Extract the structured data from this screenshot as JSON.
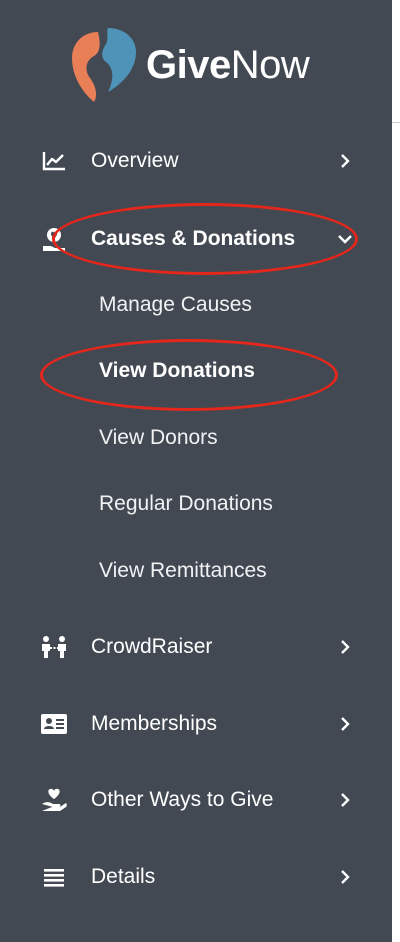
{
  "brand": {
    "name_bold": "Give",
    "name_regular": "Now"
  },
  "colors": {
    "sidebar_bg": "#434953",
    "text": "#ffffff",
    "annotation": "#e4261b",
    "logo_orange": "#e87f56",
    "logo_blue": "#4d94b8"
  },
  "nav": {
    "overview": {
      "label": "Overview",
      "icon": "line-chart-icon"
    },
    "causes": {
      "label": "Causes & Donations",
      "icon": "heart-hand-icon",
      "expanded": true,
      "sub_items": [
        {
          "label": "Manage Causes"
        },
        {
          "label": "View Donations",
          "active": true
        },
        {
          "label": "View Donors"
        },
        {
          "label": "Regular Donations"
        },
        {
          "label": "View Remittances"
        }
      ]
    },
    "crowdraiser": {
      "label": "CrowdRaiser",
      "icon": "people-icon"
    },
    "memberships": {
      "label": "Memberships",
      "icon": "id-card-icon"
    },
    "other_ways": {
      "label": "Other Ways to Give",
      "icon": "hand-heart-icon"
    },
    "details": {
      "label": "Details",
      "icon": "list-icon"
    }
  }
}
